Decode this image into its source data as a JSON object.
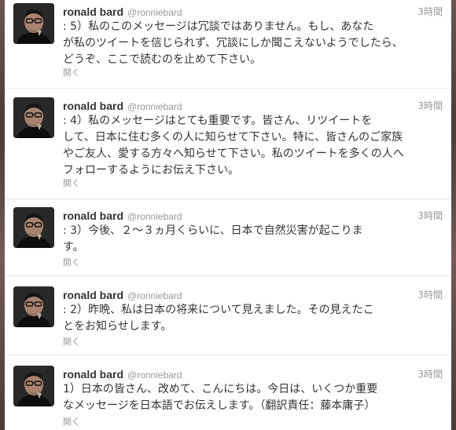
{
  "tweets": [
    {
      "name": "ronald bard",
      "handle": "@ronniebard",
      "time": "3時間",
      "lines": [
        ": 5）私のこのメッセージは冗談ではありません。もし、あなた",
        "が私のツイートを信じられず、冗談にしか聞こえないようでしたら、",
        "どうぞ、ここで読むのを止めて下さい。"
      ],
      "open_label": "開く"
    },
    {
      "name": "ronald bard",
      "handle": "@ronniebard",
      "time": "3時間",
      "lines": [
        ": 4）私のメッセージはとても重要です。皆さん、リツイートを",
        "して、日本に住む多くの人に知らせて下さい。特に、皆さんのご家族",
        "やご友人、愛する方々へ知らせて下さい。私のツイートを多くの人へ",
        "フォローするようにお伝え下さい。"
      ],
      "open_label": "開く"
    },
    {
      "name": "ronald bard",
      "handle": "@ronniebard",
      "time": "3時間",
      "lines": [
        ": 3）今後、２～３ヵ月くらいに、日本で自然災害が起こりま",
        "す。"
      ],
      "open_label": "開く"
    },
    {
      "name": "ronald bard",
      "handle": "@ronniebard",
      "time": "3時間",
      "lines": [
        ": 2）昨晩、私は日本の将来について見えました。その見えたこ",
        "とをお知らせします。"
      ],
      "open_label": "開く"
    },
    {
      "name": "ronald bard",
      "handle": "@ronniebard",
      "time": "3時間",
      "lines": [
        "1）日本の皆さん、改めて、こんにちは。今日は、いくつか重要",
        "なメッセージを日本語でお伝えします。（翻訳責任：藤本庸子）"
      ],
      "open_label": "開く"
    }
  ]
}
